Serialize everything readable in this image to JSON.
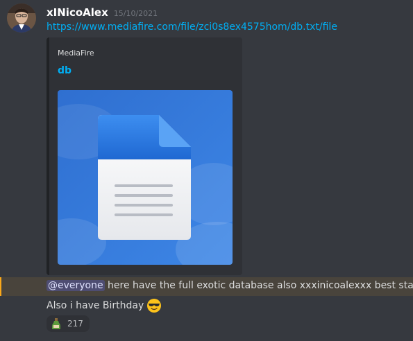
{
  "message": {
    "username": "xINicoAlex",
    "timestamp": "15/10/2021",
    "link_text": "https://www.mediafire.com/file/zci0s8ex4575hom/db.txt/file",
    "line1_after_mention": " here have the full exotic database also xxxinicoalexxx best staff",
    "mention": "@everyone",
    "line2": "Also i have Birthday",
    "line2_emoji": "sunglasses-emoji"
  },
  "embed": {
    "provider": "MediaFire",
    "title": "db",
    "image_icon": "document-file-icon"
  },
  "reaction": {
    "emoji": "bottle-emoji",
    "count": "217"
  },
  "colors": {
    "background": "#36393f",
    "link": "#00aff4",
    "mention_bg": "#49443c",
    "mention_accent": "#faa81a",
    "embed_bg": "#2f3136"
  }
}
